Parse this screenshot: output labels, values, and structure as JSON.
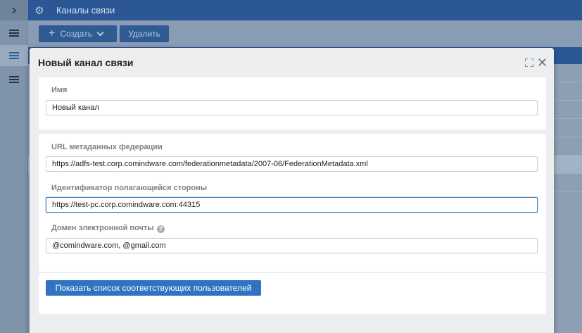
{
  "window": {
    "title": "Каналы связи"
  },
  "icons": {
    "expand": "chevron-right-icon",
    "settings": "gear-icon",
    "menu": "hamburger-icon",
    "help": "question-icon",
    "maximize": "maximize-icon",
    "close": "close-icon"
  },
  "toolbar": {
    "create_label": "Создать",
    "delete_label": "Удалить"
  },
  "modal": {
    "title": "Новый канал связи",
    "close_glyph": "✕",
    "fields": {
      "name": {
        "label": "Имя",
        "value": "Новый канал"
      },
      "federation_url": {
        "label": "URL метаданных федерации",
        "value": "https://adfs-test.corp.comindware.com/federationmetadata/2007-06/FederationMetadata.xml"
      },
      "relying_party": {
        "label": "Идентификатор полагающейся стороны",
        "value": "https://test-pc.corp.comindware.com:44315"
      },
      "email_domain": {
        "label": "Домен электронной почты",
        "value": "@comindware.com, @gmail.com"
      }
    },
    "show_users_button": "Показать список соответствующих пользователей"
  },
  "colors": {
    "accent": "#2b5797",
    "primary_button": "#2f73c2",
    "focus_border": "#4a7fc1"
  }
}
